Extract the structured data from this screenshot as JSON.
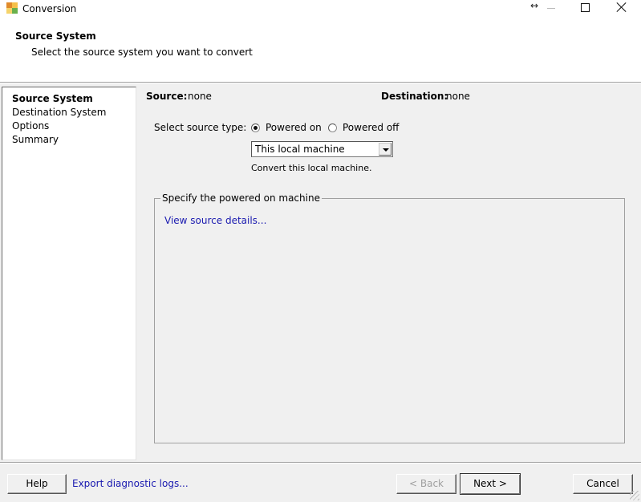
{
  "window": {
    "title": "Conversion",
    "icon": "vmware-converter-icon",
    "controls": [
      "resize-icon",
      "minimize-icon",
      "maximize-icon",
      "close-icon"
    ]
  },
  "header": {
    "title": "Source System",
    "subtitle": "Select the source system you want to convert"
  },
  "steps": [
    {
      "label": "Source System",
      "active": true
    },
    {
      "label": "Destination System",
      "active": false
    },
    {
      "label": "Options",
      "active": false
    },
    {
      "label": "Summary",
      "active": false
    }
  ],
  "summary": {
    "source_label": "Source:",
    "source_value": "none",
    "destination_label": "Destination:",
    "destination_value": "none"
  },
  "source_type": {
    "label": "Select source type:",
    "options": [
      {
        "label": "Powered on",
        "selected": true
      },
      {
        "label": "Powered off",
        "selected": false
      }
    ],
    "combo_value": "This local machine",
    "hint": "Convert this local machine."
  },
  "group": {
    "legend": "Specify the powered on machine",
    "link": "View source details..."
  },
  "footer": {
    "help": "Help",
    "export_logs": "Export diagnostic logs...",
    "back": "< Back",
    "next": "Next >",
    "cancel": "Cancel"
  },
  "colors": {
    "link": "#1a1ab0",
    "background": "#f0f0f0"
  }
}
